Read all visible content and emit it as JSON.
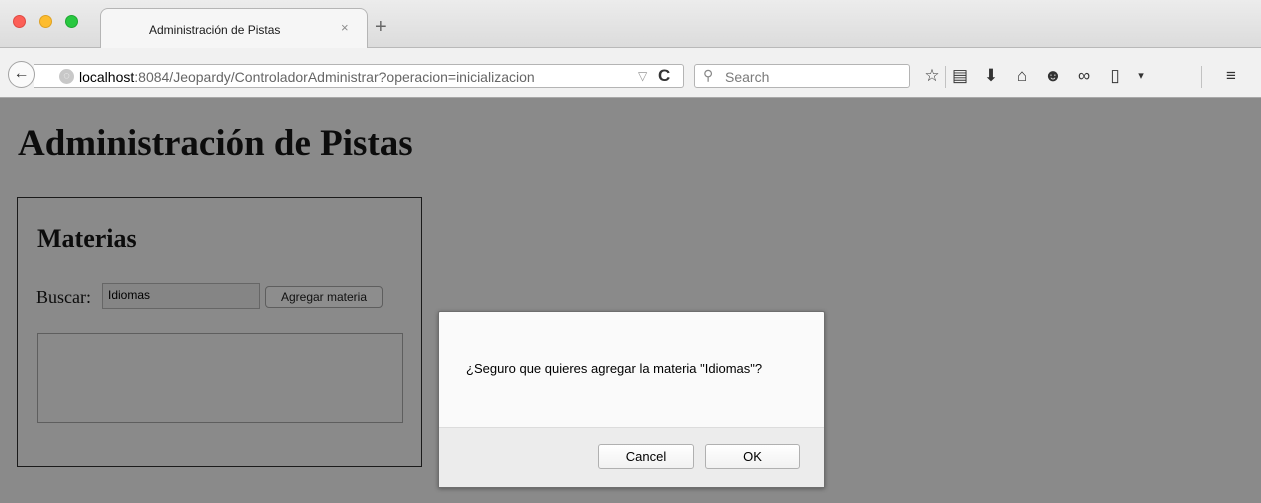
{
  "browser": {
    "tab_title": "Administración de Pistas",
    "tab_close": "×",
    "new_tab": "+",
    "url_host": "localhost",
    "url_path": ":8084/Jeopardy/ControladorAdministrar?operacion=inicializacion",
    "search_placeholder": "Search"
  },
  "page": {
    "title": "Administración de Pistas",
    "panel_title": "Materias",
    "buscar_label": "Buscar:",
    "buscar_value": "Idiomas",
    "agregar_button": "Agregar materia"
  },
  "dialog": {
    "message": "¿Seguro que quieres agregar la materia \"Idiomas\"?",
    "cancel_label": "Cancel",
    "ok_label": "OK"
  }
}
